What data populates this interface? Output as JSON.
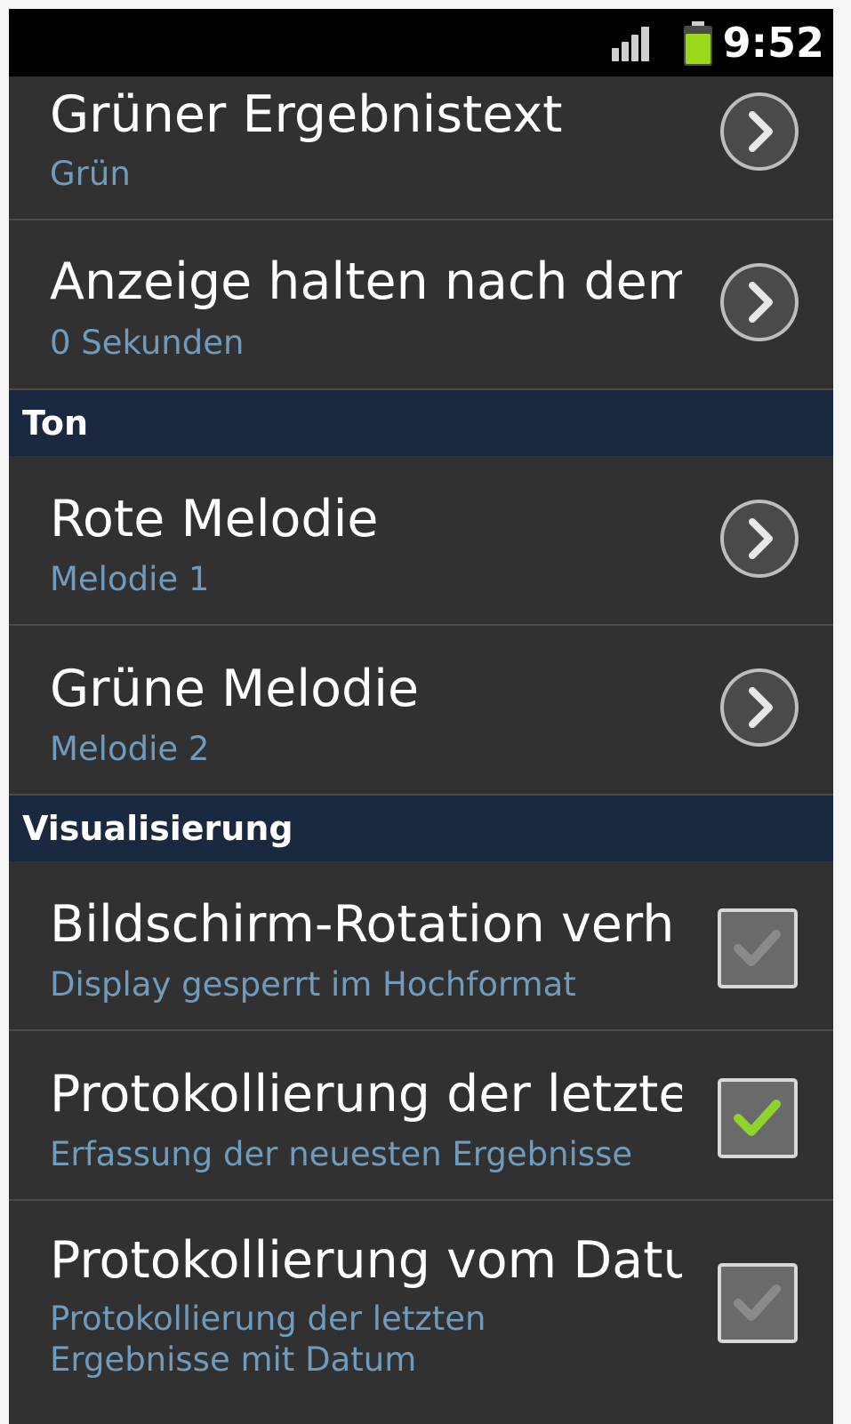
{
  "status_bar": {
    "time": "9:52",
    "signal_icon": "signal-bars-icon",
    "battery_icon": "battery-icon",
    "battery_color": "#9ad81a"
  },
  "sections": [
    {
      "type": "row",
      "title": "Grüner Ergebnistext",
      "summary": "Grün",
      "widget": "chevron"
    },
    {
      "type": "row",
      "title": "Anzeige halten nach dem",
      "summary": "0 Sekunden",
      "widget": "chevron"
    },
    {
      "type": "header",
      "label": "Ton"
    },
    {
      "type": "row",
      "title": "Rote Melodie",
      "summary": "Melodie 1",
      "widget": "chevron"
    },
    {
      "type": "row",
      "title": "Grüne Melodie",
      "summary": "Melodie 2",
      "widget": "chevron"
    },
    {
      "type": "header",
      "label": "Visualisierung"
    },
    {
      "type": "row",
      "title": "Bildschirm-Rotation verh",
      "summary": "Display gesperrt im Hochformat",
      "widget": "checkbox",
      "checked": false
    },
    {
      "type": "row",
      "title": "Protokollierung der letzte",
      "summary": "Erfassung der neuesten Ergebnisse",
      "widget": "checkbox",
      "checked": true
    },
    {
      "type": "row",
      "title": "Protokollierung vom Datu",
      "summary": "Protokollierung der letzten Ergebnisse mit Datum",
      "widget": "checkbox",
      "checked": false
    }
  ],
  "colors": {
    "background": "#313131",
    "header": "#1a2940",
    "summary": "#6f9bbd",
    "check_on": "#8fd42a"
  }
}
